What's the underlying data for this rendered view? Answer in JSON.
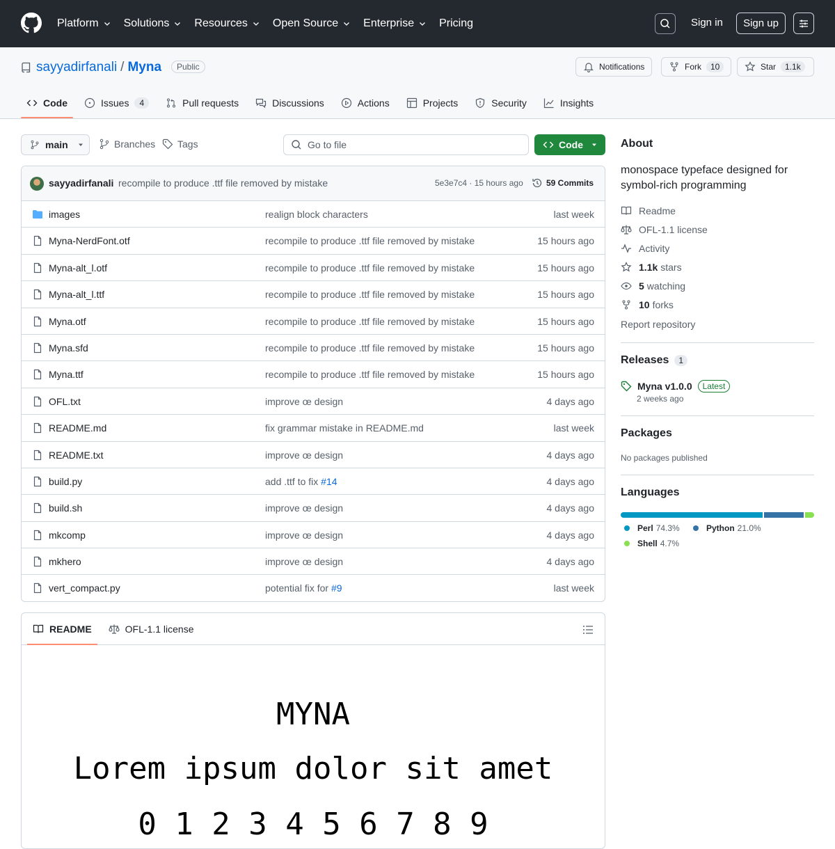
{
  "nav": {
    "items": [
      "Platform",
      "Solutions",
      "Resources",
      "Open Source",
      "Enterprise",
      "Pricing"
    ],
    "sign_in": "Sign in",
    "sign_up": "Sign up"
  },
  "repo": {
    "owner": "sayyadirfanali",
    "separator": "/",
    "name": "Myna",
    "visibility": "Public",
    "notifications_label": "Notifications",
    "fork_label": "Fork",
    "fork_count": "10",
    "star_label": "Star",
    "star_count": "1.1k"
  },
  "tabs": [
    {
      "label": "Code",
      "icon": "code-icon",
      "count": ""
    },
    {
      "label": "Issues",
      "icon": "issue-icon",
      "count": "4"
    },
    {
      "label": "Pull requests",
      "icon": "pull-request-icon",
      "count": ""
    },
    {
      "label": "Discussions",
      "icon": "discussions-icon",
      "count": ""
    },
    {
      "label": "Actions",
      "icon": "play-icon",
      "count": ""
    },
    {
      "label": "Projects",
      "icon": "table-icon",
      "count": ""
    },
    {
      "label": "Security",
      "icon": "shield-icon",
      "count": ""
    },
    {
      "label": "Insights",
      "icon": "graph-icon",
      "count": ""
    }
  ],
  "toolbar": {
    "branch": "main",
    "branches_label": "Branches",
    "tags_label": "Tags",
    "goto_placeholder": "Go to file",
    "code_label": "Code"
  },
  "commit": {
    "author": "sayyadirfanali",
    "message": "recompile to produce .ttf file removed by mistake",
    "meta": "5e3e7c4 · 15 hours ago",
    "count_label": "59 Commits"
  },
  "files": [
    {
      "name": "images",
      "type": "folder",
      "message": "realign block characters",
      "ref": "",
      "time": "last week"
    },
    {
      "name": "Myna-NerdFont.otf",
      "type": "file",
      "message": "recompile to produce .ttf file removed by mistake",
      "ref": "",
      "time": "15 hours ago"
    },
    {
      "name": "Myna-alt_l.otf",
      "type": "file",
      "message": "recompile to produce .ttf file removed by mistake",
      "ref": "",
      "time": "15 hours ago"
    },
    {
      "name": "Myna-alt_l.ttf",
      "type": "file",
      "message": "recompile to produce .ttf file removed by mistake",
      "ref": "",
      "time": "15 hours ago"
    },
    {
      "name": "Myna.otf",
      "type": "file",
      "message": "recompile to produce .ttf file removed by mistake",
      "ref": "",
      "time": "15 hours ago"
    },
    {
      "name": "Myna.sfd",
      "type": "file",
      "message": "recompile to produce .ttf file removed by mistake",
      "ref": "",
      "time": "15 hours ago"
    },
    {
      "name": "Myna.ttf",
      "type": "file",
      "message": "recompile to produce .ttf file removed by mistake",
      "ref": "",
      "time": "15 hours ago"
    },
    {
      "name": "OFL.txt",
      "type": "file",
      "message": "improve œ design",
      "ref": "",
      "time": "4 days ago"
    },
    {
      "name": "README.md",
      "type": "file",
      "message": "fix grammar mistake in README.md",
      "ref": "",
      "time": "last week"
    },
    {
      "name": "README.txt",
      "type": "file",
      "message": "improve œ design",
      "ref": "",
      "time": "4 days ago"
    },
    {
      "name": "build.py",
      "type": "file",
      "message": "add .ttf to fix ",
      "ref": "#14",
      "time": "4 days ago"
    },
    {
      "name": "build.sh",
      "type": "file",
      "message": "improve œ design",
      "ref": "",
      "time": "4 days ago"
    },
    {
      "name": "mkcomp",
      "type": "file",
      "message": "improve œ design",
      "ref": "",
      "time": "4 days ago"
    },
    {
      "name": "mkhero",
      "type": "file",
      "message": "improve œ design",
      "ref": "",
      "time": "4 days ago"
    },
    {
      "name": "vert_compact.py",
      "type": "file",
      "message": "potential fix for ",
      "ref": "#9",
      "time": "last week"
    }
  ],
  "readme": {
    "tab_readme": "README",
    "tab_license": "OFL-1.1 license",
    "title": "MYNA",
    "lorem": "Lorem ipsum dolor sit amet",
    "digits": "0 1 2 3 4 5 6 7 8 9"
  },
  "about": {
    "heading": "About",
    "description": "monospace typeface designed for symbol-rich programming",
    "readme": "Readme",
    "license": "OFL-1.1 license",
    "activity": "Activity",
    "stars_count": "1.1k",
    "stars_label": "stars",
    "watching_count": "5",
    "watching_label": "watching",
    "forks_count": "10",
    "forks_label": "forks",
    "report": "Report repository"
  },
  "releases": {
    "heading": "Releases",
    "count": "1",
    "name": "Myna v1.0.0",
    "badge": "Latest",
    "date": "2 weeks ago"
  },
  "packages": {
    "heading": "Packages",
    "none": "No packages published"
  },
  "languages": {
    "heading": "Languages",
    "items": [
      {
        "name": "Perl",
        "percent": "74.3%",
        "value": 74.3,
        "color": "#0298c3"
      },
      {
        "name": "Python",
        "percent": "21.0%",
        "value": 21.0,
        "color": "#3572A5"
      },
      {
        "name": "Shell",
        "percent": "4.7%",
        "value": 4.7,
        "color": "#89e051"
      }
    ]
  }
}
